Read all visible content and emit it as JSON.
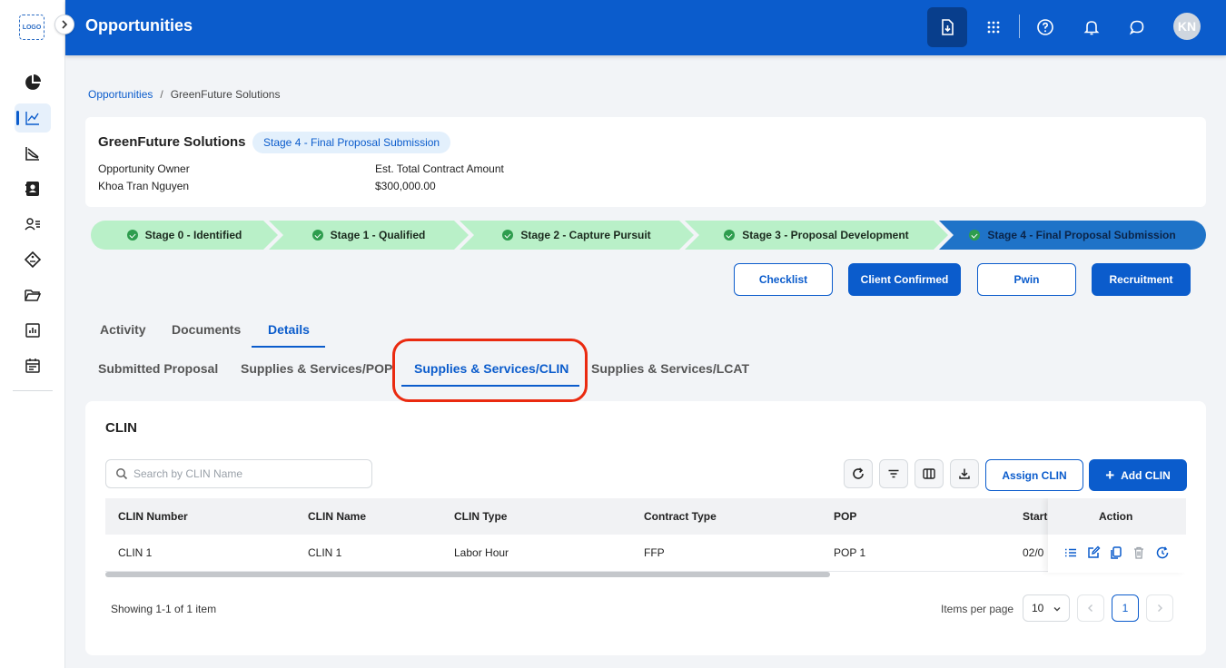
{
  "app": {
    "logo_text": "LOGO",
    "page_title": "Opportunities",
    "avatar_initials": "KN"
  },
  "breadcrumb": {
    "root": "Opportunities",
    "separator": "/",
    "current": "GreenFuture Solutions"
  },
  "summary": {
    "name": "GreenFuture Solutions",
    "stage_badge": "Stage 4 - Final Proposal Submission",
    "owner_label": "Opportunity Owner",
    "owner_value": "Khoa Tran Nguyen",
    "amount_label": "Est. Total Contract Amount",
    "amount_value": "$300,000.00"
  },
  "stages": [
    {
      "label": "Stage 0 - Identified",
      "status": "done"
    },
    {
      "label": "Stage 1 - Qualified",
      "status": "done"
    },
    {
      "label": "Stage 2 - Capture Pursuit",
      "status": "done"
    },
    {
      "label": "Stage 3 - Proposal Development",
      "status": "done"
    },
    {
      "label": "Stage 4 - Final Proposal Submission",
      "status": "current"
    }
  ],
  "actions": {
    "checklist": "Checklist",
    "client_confirmed": "Client Confirmed",
    "pwin": "Pwin",
    "recruitment": "Recruitment"
  },
  "tabs": {
    "primary": [
      "Activity",
      "Documents",
      "Details"
    ],
    "primary_active": "Details",
    "secondary": [
      "Submitted Proposal",
      "Supplies & Services/POP",
      "Supplies & Services/CLIN",
      "Supplies & Services/LCAT"
    ],
    "secondary_active": "Supplies & Services/CLIN"
  },
  "clin": {
    "title": "CLIN",
    "search_placeholder": "Search by CLIN Name",
    "assign_label": "Assign CLIN",
    "add_label": "Add CLIN",
    "add_icon_glyph": "+",
    "columns": [
      "CLIN Number",
      "CLIN Name",
      "CLIN Type",
      "Contract Type",
      "POP",
      "Start",
      "Action"
    ],
    "rows": [
      {
        "number": "CLIN 1",
        "name": "CLIN 1",
        "type": "Labor Hour",
        "contract_type": "FFP",
        "pop": "POP 1",
        "start": "02/0"
      }
    ],
    "showing": "Showing 1-1 of 1 item",
    "items_per_page_label": "Items per page",
    "items_per_page": "10",
    "current_page": "1"
  },
  "colors": {
    "brand": "#0b5ccc",
    "stage_done": "#b9f0c8",
    "stage_current": "#1f73c8",
    "highlight_ring": "#ea2a10"
  }
}
